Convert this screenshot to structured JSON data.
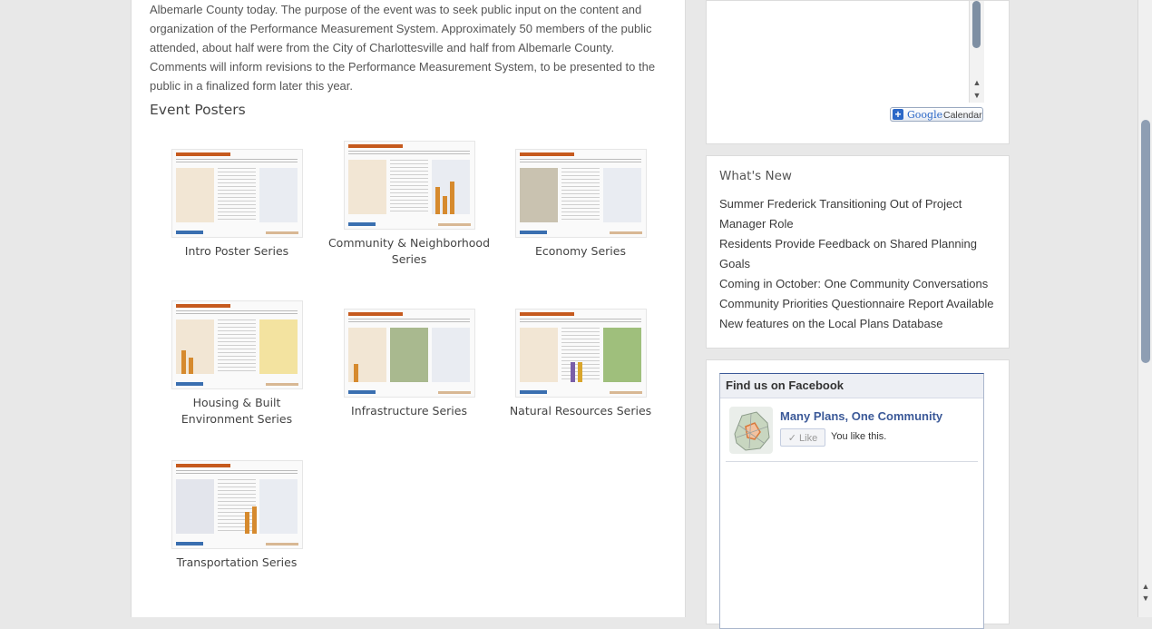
{
  "main": {
    "intro_text": "Albemarle County today. The purpose of the event was to seek public input on the content and organization of the Performance Measurement System. Approximately 50 members of the public attended, about half were from the City of Charlottesville and half from Albemarle County. Comments will inform revisions to the Performance Measurement System, to be presented to the public in a finalized form later this year.",
    "section_title": "Event Posters",
    "posters": [
      {
        "caption": "Intro Poster Series"
      },
      {
        "caption": "Community & Neighborhood Series"
      },
      {
        "caption": "Economy Series"
      },
      {
        "caption": "Housing & Built Environment Series"
      },
      {
        "caption": "Infrastructure Series"
      },
      {
        "caption": "Natural Resources Series"
      },
      {
        "caption": "Transportation Series"
      }
    ]
  },
  "sidebar": {
    "calendar": {
      "button_google": "Google",
      "button_calendar": "Calendar"
    },
    "whats_new": {
      "title": "What's New",
      "items": [
        "Summer Frederick Transitioning Out of Project Manager Role",
        "Residents Provide Feedback on Shared Planning Goals",
        "Coming in October: One Community Conversations",
        "Community Priorities Questionnaire Report Available",
        "New features on the Local Plans Database"
      ]
    },
    "facebook": {
      "header": "Find us on Facebook",
      "page_name": "Many Plans, One Community",
      "like_button": "Like",
      "like_status": "You like this."
    }
  },
  "colors": {
    "accent_orange": "#c65a1e",
    "facebook_blue": "#3b5998",
    "google_blue": "#2a67c7"
  }
}
